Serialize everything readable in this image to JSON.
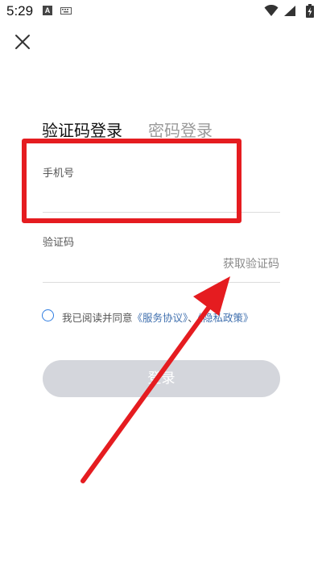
{
  "status_bar": {
    "time": "5:29",
    "notification_letter": "A",
    "icons": [
      "wifi-icon",
      "signal-icon",
      "battery-charging-icon"
    ]
  },
  "header": {
    "close_icon": "close-icon"
  },
  "tabs": [
    {
      "label": "验证码登录",
      "active": true
    },
    {
      "label": "密码登录",
      "active": false
    }
  ],
  "form": {
    "phone_label": "手机号",
    "phone_value": "",
    "code_label": "验证码",
    "code_value": "",
    "get_code_label": "获取验证码"
  },
  "agreement": {
    "prefix": "我已阅读并同意",
    "service_link": "《服务协议》",
    "joiner": "、",
    "privacy_link": "《隐私政策》",
    "checked": false
  },
  "login_button": {
    "label": "登录",
    "enabled": false
  },
  "colors": {
    "annotation": "#e51c20",
    "link": "#3f6fae",
    "radio": "#2f7de1",
    "button_disabled": "#d4d6dc"
  }
}
